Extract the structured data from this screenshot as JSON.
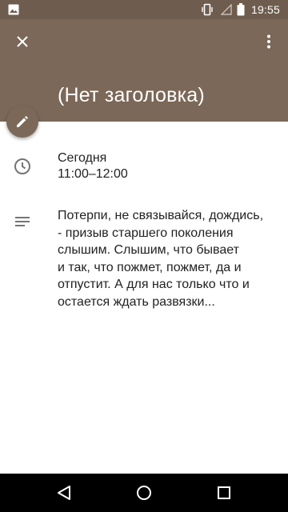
{
  "status_bar": {
    "time": "19:55",
    "icons": [
      "image-notification-icon",
      "vibrate-icon",
      "signal-empty-icon",
      "battery-icon"
    ]
  },
  "header": {
    "title": "(Нет заголовка)",
    "close_icon": "close-icon",
    "more_icon": "more-vert-icon",
    "background_color": "#7b6858"
  },
  "fab": {
    "icon": "edit-pencil-icon"
  },
  "event": {
    "day": "Сегодня",
    "time_range": "11:00–12:00",
    "description": "Потерпи, не связывайся, дождись,\n- призыв старшего поколения\nслышим. Слышим, что бывает\nи так,  что пожмет, пожмет, да и\nотпустит. А для нас только что и\nостается ждать развязки..."
  },
  "nav_bar": {
    "buttons": [
      "back-icon",
      "home-icon",
      "recents-icon"
    ]
  }
}
